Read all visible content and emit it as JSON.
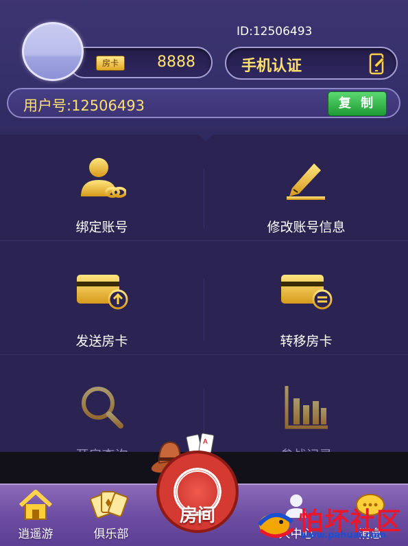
{
  "header": {
    "card_badge": "房卡",
    "card_count": "8888",
    "id_label": "ID:12506493",
    "phone_verify": "手机认证",
    "user_number": "用户号:12506493",
    "copy_label": "复 制"
  },
  "menu": {
    "items": [
      {
        "label": "绑定账号",
        "icon": "user-link-icon"
      },
      {
        "label": "修改账号信息",
        "icon": "pencil-edit-icon"
      },
      {
        "label": "发送房卡",
        "icon": "card-send-icon"
      },
      {
        "label": "转移房卡",
        "icon": "card-transfer-icon"
      },
      {
        "label": "开房查询",
        "icon": "magnifier-icon"
      },
      {
        "label": "参战记录",
        "icon": "bar-chart-icon"
      }
    ]
  },
  "tabbar": {
    "tabs": [
      {
        "label": "逍遥游",
        "icon": "home-icon"
      },
      {
        "label": "俱乐部",
        "icon": "cards-icon"
      },
      {
        "label": "人中心",
        "icon": "person-icon"
      },
      {
        "label": "消息",
        "icon": "message-icon"
      }
    ],
    "center_label": "房间"
  },
  "watermark": {
    "text": "怕坏社区",
    "url": "www.pahuai.com"
  },
  "colors": {
    "accent_gold": "#ffe071",
    "background": "#2b2452",
    "copy_green": "#1f9b35",
    "tabbar_purple": "#6e4ea3"
  }
}
